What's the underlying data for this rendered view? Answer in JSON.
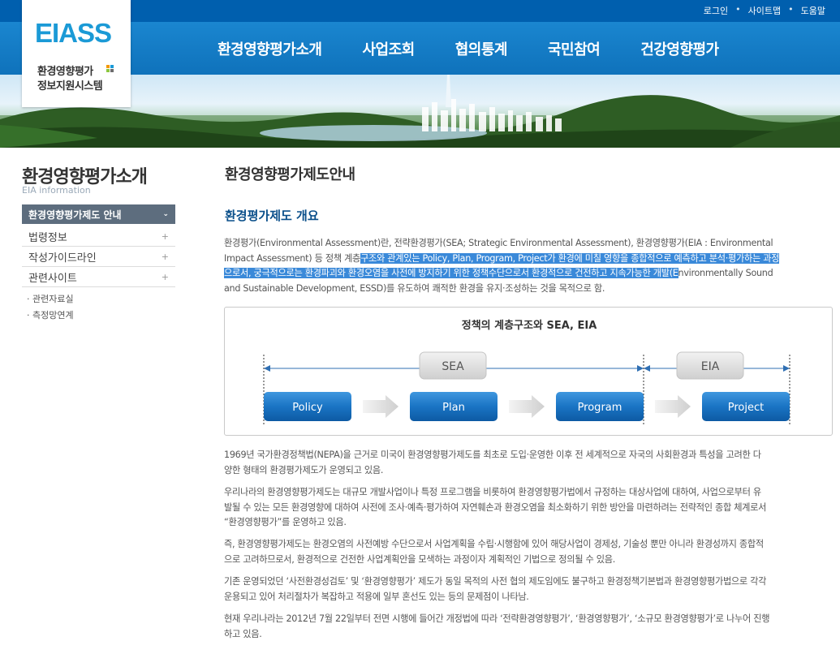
{
  "util_links": [
    "로그인",
    "사이트맵",
    "도움말"
  ],
  "logo": {
    "mark": "EIASS",
    "line1": "환경영향평가",
    "line2": "정보지원시스템",
    "colors": [
      "#f39800",
      "#1b9ad6",
      "#8cc63f",
      "#6c6c6c"
    ]
  },
  "gnb": [
    "환경영향평가소개",
    "사업조회",
    "협의통계",
    "국민참여",
    "건강영향평가"
  ],
  "lnb": {
    "title": "환경영향평가소개",
    "subtitle": "EIA information",
    "items": [
      {
        "label": "환경영향평가제도 안내",
        "icon": "chevron-down-icon",
        "active": true
      },
      {
        "label": "법령정보",
        "icon": "plus-icon"
      },
      {
        "label": "작성가이드라인",
        "icon": "plus-icon"
      },
      {
        "label": "관련사이트",
        "icon": "plus-icon"
      }
    ],
    "sub_links": [
      "· 관련자료실",
      "· 측정망연계"
    ]
  },
  "content": {
    "page_title": "환경영향평가제도안내",
    "section_title": "환경평가제도 개요",
    "intro": {
      "line1": "환경평가(Environmental Assessment)란, 전략환경평가(SEA; Strategic Environmental Assessment), 환경영향평가(EIA : Environmental",
      "line2_a": "Impact Assessment) 등 정책 계층",
      "line2_b": "구조와 관계있는 Policy, Plan, Program, Project가 환경에 미칠 영향을 종합적으로 예측하고 분석·평가하는 과정",
      "line3_a": "으로서, 궁극적으로는 환경파괴와 환경오염을 사전에 방지하기 위한 정책수단으로서 환경적으로 건전하고 지속가능한 개발(E",
      "line3_b": "nvironmentally Sound",
      "line4": "and Sustainable Development, ESSD)를 유도하여 쾌적한 환경을 유지·조성하는 것을 목적으로 함."
    },
    "diagram": {
      "title": "정책의 계층구조와 SEA, EIA",
      "sea_label": "SEA",
      "eia_label": "EIA",
      "stages": [
        "Policy",
        "Plan",
        "Program",
        "Project"
      ]
    },
    "paragraphs": [
      [
        "1969년 국가환경정책법(NEPA)을 근거로 미국이 환경영향평가제도를 최초로 도입·운영한 이후 전 세계적으로 자국의 사회환경과 특성을 고려한 다",
        "양한 형태의 환경평가제도가 운영되고 있음."
      ],
      [
        "우리나라의 환경영향평가제도는 대규모 개발사업이나 특정 프로그램을 비롯하여 환경영향평가법에서 규정하는 대상사업에 대하여, 사업으로부터 유",
        "발될 수 있는 모든 환경영향에 대하여 사전에 조사·예측·평가하여 자연훼손과 환경오염을 최소화하기 위한 방안을 마련하려는 전략적인 종합 체계로서",
        "“환경영향평가”를 운영하고 있음."
      ],
      [
        "즉, 환경영향평가제도는 환경오염의 사전예방 수단으로서 사업계획을 수립·시행함에 있어 해당사업이 경제성, 기술성 뿐만 아니라 환경성까지 종합적",
        "으로 고려하므로서, 환경적으로 건전한 사업계획안을 모색하는 과정이자 계획적인 기법으로 정의될 수 있음."
      ],
      [
        "기존 운영되었던 ‘사전환경성검토’ 및 ‘환경영향평가’ 제도가 동일 목적의 사전 협의 제도임에도 불구하고 환경정책기본법과 환경영향평가법으로 각각",
        "운용되고 있어 처리절차가 복잡하고 적용에 일부 혼선도 있는 등의 문제점이 나타남."
      ],
      [
        "현재 우리나라는 2012년 7월 22일부터 전면 시행에 들어간 개정법에 따라 ‘전략환경영향평가’, ‘환경영향평가’, ‘소규모 환경영향평가’로 나누어 진행",
        "하고 있음."
      ]
    ]
  }
}
